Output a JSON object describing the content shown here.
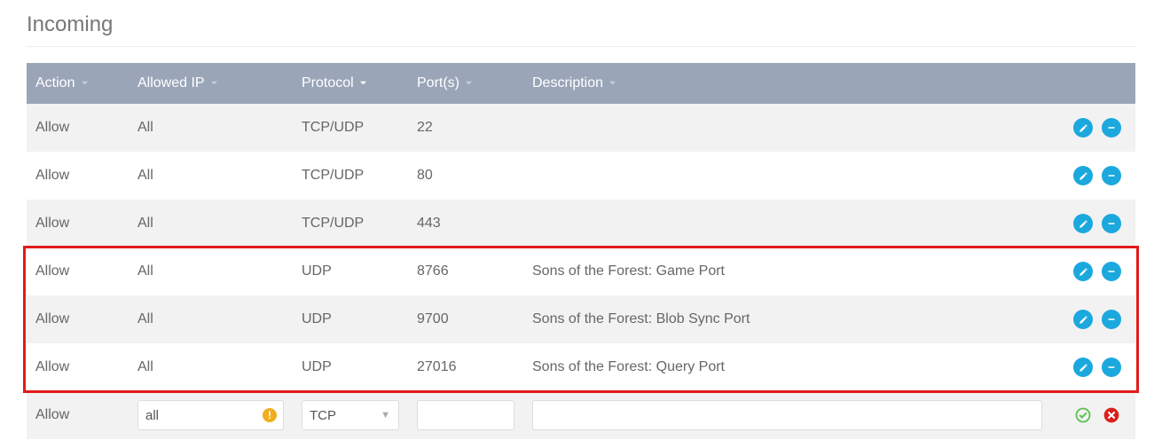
{
  "section_title": "Incoming",
  "columns": {
    "action": "Action",
    "allowed_ip": "Allowed IP",
    "protocol": "Protocol",
    "ports": "Port(s)",
    "description": "Description"
  },
  "rows": [
    {
      "action": "Allow",
      "ip": "All",
      "protocol": "TCP/UDP",
      "ports": "22",
      "description": ""
    },
    {
      "action": "Allow",
      "ip": "All",
      "protocol": "TCP/UDP",
      "ports": "80",
      "description": ""
    },
    {
      "action": "Allow",
      "ip": "All",
      "protocol": "TCP/UDP",
      "ports": "443",
      "description": ""
    },
    {
      "action": "Allow",
      "ip": "All",
      "protocol": "UDP",
      "ports": "8766",
      "description": "Sons of the Forest: Game Port"
    },
    {
      "action": "Allow",
      "ip": "All",
      "protocol": "UDP",
      "ports": "9700",
      "description": "Sons of the Forest: Blob Sync Port"
    },
    {
      "action": "Allow",
      "ip": "All",
      "protocol": "UDP",
      "ports": "27016",
      "description": "Sons of the Forest: Query Port"
    }
  ],
  "input_row": {
    "action": "Allow",
    "ip_value": "all",
    "protocol_value": "TCP",
    "ports_value": "",
    "description_value": ""
  },
  "icons": {
    "edit": "pencil-icon",
    "remove": "minus-icon",
    "confirm": "check-icon",
    "cancel": "x-icon",
    "warn": "warn-icon",
    "sort": "caret-down-icon"
  },
  "colors": {
    "header_bg": "#9aa5b8",
    "accent": "#1ba8de",
    "confirm": "#5bc24f",
    "cancel": "#d9201c",
    "highlight": "#e11b1b",
    "warn": "#f0ad1e"
  }
}
